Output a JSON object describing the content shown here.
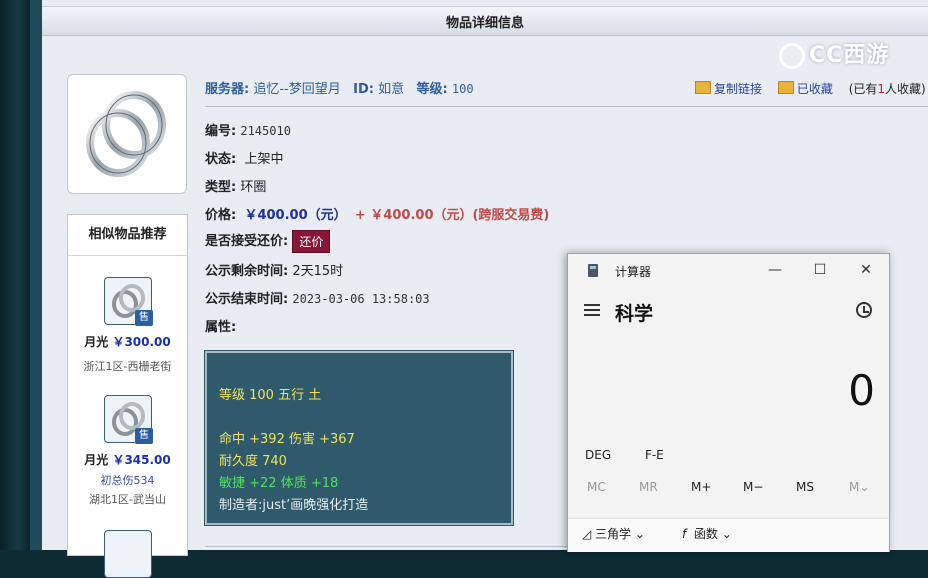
{
  "header": {
    "title": "物品详细信息"
  },
  "logo": {
    "text": "CC西游"
  },
  "similar": {
    "title": "相似物品推荐",
    "items": [
      {
        "name": "月光",
        "price": "￥300.00",
        "sub1": "",
        "sub2": "浙江1区-西栅老街",
        "badge": "售"
      },
      {
        "name": "月光",
        "price": "￥345.00",
        "sub1": "初总伤534",
        "sub2": "湖北1区-武当山",
        "badge": "售"
      }
    ]
  },
  "info": {
    "server_label": "服务器:",
    "server_value": "追忆--梦回望月",
    "id_label": "ID:",
    "id_value": "如意",
    "level_label": "等级:",
    "level_value": "100",
    "number_label": "编号:",
    "number_value": "2145010",
    "status_label": "状态:",
    "status_value": "上架中",
    "type_label": "类型:",
    "type_value": "环圈",
    "price_label": "价格:",
    "price_value": "￥400.00（元）",
    "price_extra": "+ ￥400.00（元）(跨服交易费)",
    "bargain_label": "是否接受还价:",
    "bargain_button": "还价",
    "remaining_label": "公示剩余时间:",
    "remaining_value": "2天15时",
    "end_label": "公示结束时间:",
    "end_value": "2023-03-06 13:58:03",
    "attr_label": "属性:"
  },
  "actions": {
    "copy_link": "复制链接",
    "favorited": "已收藏",
    "fav_prefix": "(已有",
    "fav_num": "1",
    "fav_suffix": "人收藏)"
  },
  "attributes": {
    "line1": "等级 100 五行 土",
    "line2": "命中 +392 伤害 +367",
    "line3": "耐久度 740",
    "line4": "敏捷 +22 体质 +18",
    "line5": "制造者:just’画晚强化打造"
  },
  "calculator": {
    "title": "计算器",
    "mode": "科学",
    "display": "0",
    "deg": "DEG",
    "fe": "F-E",
    "memory": [
      "MC",
      "MR",
      "M+",
      "M−",
      "MS",
      "M⌄"
    ],
    "trig": "三角学",
    "func": "函数",
    "controls": {
      "minimize": "—",
      "maximize": "☐",
      "close": "✕"
    }
  },
  "colors": {
    "accent_blue": "#1a2fa0",
    "price_red": "#c24a4a",
    "bargain_btn": "#8b1535",
    "attr_bg": "#2f5a6b"
  }
}
